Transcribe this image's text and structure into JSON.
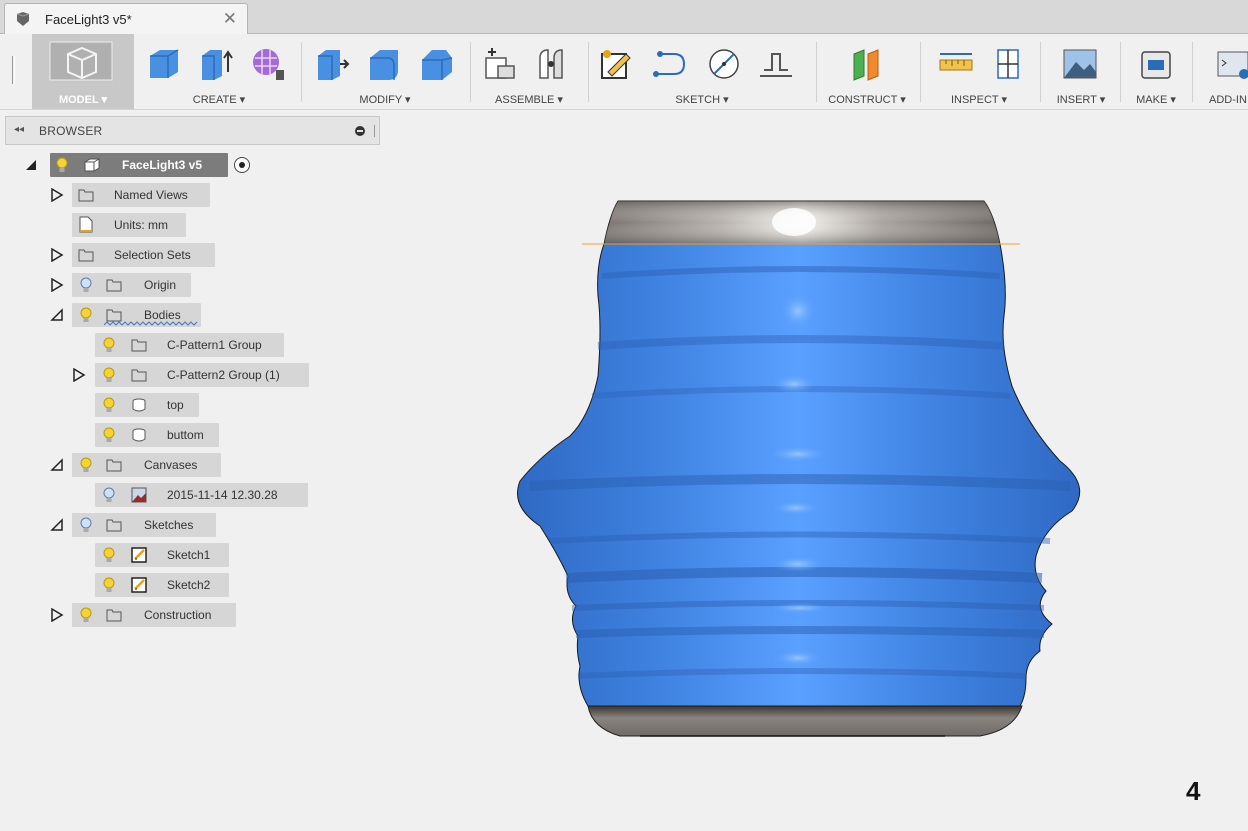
{
  "document_tab": {
    "title": "FaceLight3 v5*",
    "close": "✕"
  },
  "toolbar": {
    "groups": [
      {
        "label": "MODEL ▾"
      },
      {
        "label": "CREATE ▾"
      },
      {
        "label": "MODIFY ▾"
      },
      {
        "label": "ASSEMBLE ▾"
      },
      {
        "label": "SKETCH ▾"
      },
      {
        "label": "CONSTRUCT ▾"
      },
      {
        "label": "INSPECT ▾"
      },
      {
        "label": "INSERT ▾"
      },
      {
        "label": "MAKE ▾"
      },
      {
        "label": "ADD-IN"
      }
    ]
  },
  "browser": {
    "collapse": "◂◂",
    "title": "BROWSER",
    "items": [
      {
        "label": "FaceLight3 v5"
      },
      {
        "label": "Named Views"
      },
      {
        "label": "Units: mm"
      },
      {
        "label": "Selection Sets"
      },
      {
        "label": "Origin"
      },
      {
        "label": "Bodies"
      },
      {
        "label": "C-Pattern1 Group"
      },
      {
        "label": "C-Pattern2 Group (1)"
      },
      {
        "label": "top"
      },
      {
        "label": "buttom"
      },
      {
        "label": "Canvases"
      },
      {
        "label": "2015-11-14 12.30.28"
      },
      {
        "label": "Sketches"
      },
      {
        "label": "Sketch1"
      },
      {
        "label": "Sketch2"
      },
      {
        "label": "Construction"
      }
    ]
  },
  "colors": {
    "body_blue": "#3d7fd8",
    "cap_grey": "#8a8480",
    "active_tool": "#c8c8c8"
  },
  "page_number": "4"
}
